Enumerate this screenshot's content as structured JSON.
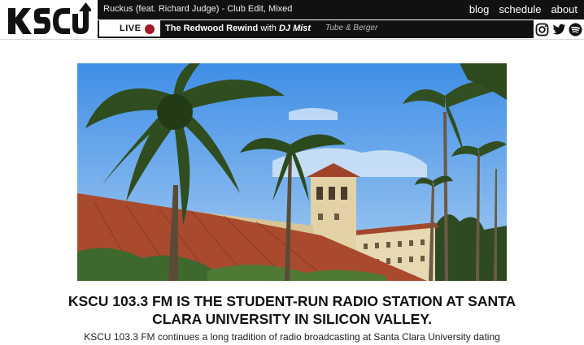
{
  "site": {
    "logo_text": "KSCU"
  },
  "now_playing": {
    "track": "Ruckus (feat. Richard Judge) - Club Edit, Mixed"
  },
  "nav": {
    "items": [
      "blog",
      "schedule",
      "about"
    ]
  },
  "live": {
    "label": "LIVE",
    "show_name": "The Redwood Rewind",
    "with_text": "with",
    "dj": "DJ Mist",
    "up_next": "Tube & Berger"
  },
  "socials": {
    "icons": [
      "instagram-icon",
      "twitter-icon",
      "spotify-icon"
    ]
  },
  "main": {
    "headline": "KSCU 103.3 FM is the student-run radio station at Santa Clara University in Silicon Valley.",
    "intro": "KSCU 103.3 FM continues a long tradition of radio broadcasting at Santa Clara University dating"
  },
  "colors": {
    "live_dot": "#a21a24",
    "bar": "#111111"
  }
}
